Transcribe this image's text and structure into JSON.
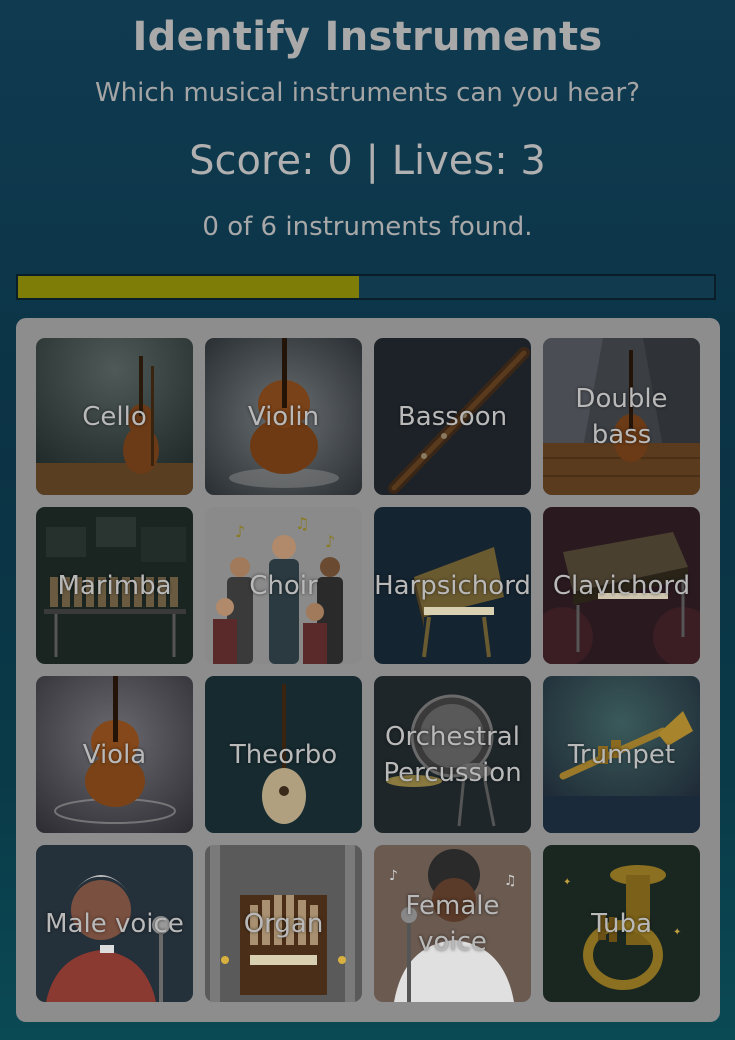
{
  "header": {
    "title": "Identify Instruments",
    "subtitle": "Which musical instruments can you hear?",
    "score_line": "Score: 0 | Lives: 3",
    "found_line": "0 of 6 instruments found."
  },
  "progress": {
    "fraction": 0.49,
    "fill_color": "#7d7d08"
  },
  "instruments": [
    {
      "label": "Cello",
      "icon": "cello-icon"
    },
    {
      "label": "Violin",
      "icon": "violin-icon"
    },
    {
      "label": "Bassoon",
      "icon": "bassoon-icon"
    },
    {
      "label": "Double bass",
      "icon": "double-bass-icon"
    },
    {
      "label": "Marimba",
      "icon": "marimba-icon"
    },
    {
      "label": "Choir",
      "icon": "choir-icon"
    },
    {
      "label": "Harpsichord",
      "icon": "harpsichord-icon"
    },
    {
      "label": "Clavichord",
      "icon": "clavichord-icon"
    },
    {
      "label": "Viola",
      "icon": "viola-icon"
    },
    {
      "label": "Theorbo",
      "icon": "theorbo-icon"
    },
    {
      "label": "Orchestral Percussion",
      "icon": "percussion-icon"
    },
    {
      "label": "Trumpet",
      "icon": "trumpet-icon"
    },
    {
      "label": "Male voice",
      "icon": "male-singer-icon"
    },
    {
      "label": "Organ",
      "icon": "organ-icon"
    },
    {
      "label": "Female voice",
      "icon": "female-singer-icon"
    },
    {
      "label": "Tuba",
      "icon": "tuba-icon"
    }
  ]
}
